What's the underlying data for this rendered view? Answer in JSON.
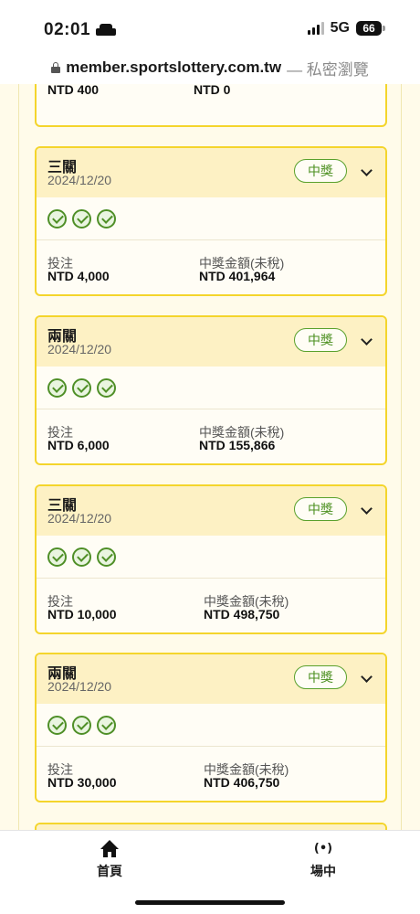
{
  "status_bar": {
    "time": "02:01",
    "network": "5G",
    "battery": "66"
  },
  "url_bar": {
    "domain": "member.sportslottery.com.tw",
    "suffix": " — 私密瀏覽"
  },
  "top_partial_card": {
    "left_value": "NTD 400",
    "right_value": "NTD 0"
  },
  "labels": {
    "bet": "投注",
    "prize": "中獎金額(未稅)"
  },
  "cards": [
    {
      "type": "三關",
      "date": "2024/12/20",
      "badge": "中獎",
      "bet": "NTD 4,000",
      "prize": "NTD 401,964",
      "checks": 3
    },
    {
      "type": "兩關",
      "date": "2024/12/20",
      "badge": "中獎",
      "bet": "NTD 6,000",
      "prize": "NTD 155,866",
      "checks": 3
    },
    {
      "type": "三關",
      "date": "2024/12/20",
      "badge": "中獎",
      "bet": "NTD 10,000",
      "prize": "NTD 498,750",
      "checks": 3
    },
    {
      "type": "兩關",
      "date": "2024/12/20",
      "badge": "中獎",
      "bet": "NTD 30,000",
      "prize": "NTD 406,750",
      "checks": 3
    }
  ],
  "bottom_nav": {
    "home_label": "首頁",
    "live_label": "場中",
    "live_icon": "(•)"
  },
  "colors": {
    "card_border": "#f4d52c",
    "card_header": "#fdf1c4",
    "win_green": "#4b8f1f",
    "page_bg": "#fffbea"
  }
}
